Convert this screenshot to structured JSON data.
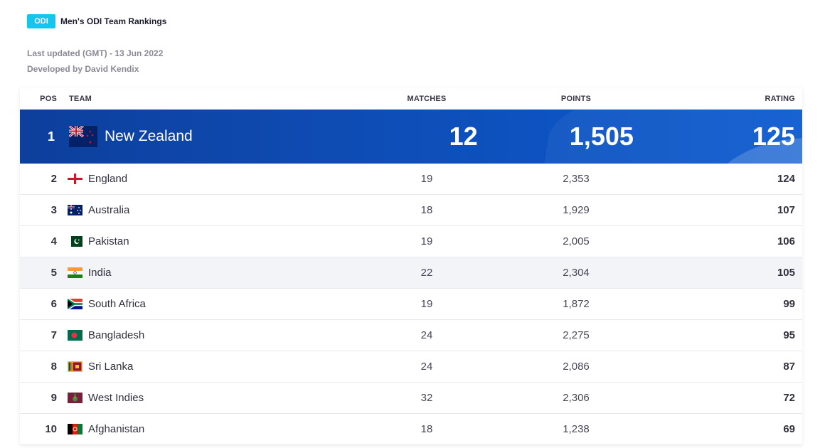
{
  "header": {
    "badge": "ODI",
    "title": "Men's ODI Team Rankings",
    "last_updated": "Last updated (GMT) - 13 Jun 2022",
    "developed_by": "Developed by David Kendix"
  },
  "columns": {
    "pos": "POS",
    "team": "TEAM",
    "matches": "MATCHES",
    "points": "POINTS",
    "rating": "RATING"
  },
  "rows": [
    {
      "pos": "1",
      "team": "New Zealand",
      "matches": "12",
      "points": "1,505",
      "rating": "125",
      "flag_icon": "new-zealand-flag-icon"
    },
    {
      "pos": "2",
      "team": "England",
      "matches": "19",
      "points": "2,353",
      "rating": "124",
      "flag_icon": "england-flag-icon"
    },
    {
      "pos": "3",
      "team": "Australia",
      "matches": "18",
      "points": "1,929",
      "rating": "107",
      "flag_icon": "australia-flag-icon"
    },
    {
      "pos": "4",
      "team": "Pakistan",
      "matches": "19",
      "points": "2,005",
      "rating": "106",
      "flag_icon": "pakistan-flag-icon"
    },
    {
      "pos": "5",
      "team": "India",
      "matches": "22",
      "points": "2,304",
      "rating": "105",
      "flag_icon": "india-flag-icon"
    },
    {
      "pos": "6",
      "team": "South Africa",
      "matches": "19",
      "points": "1,872",
      "rating": "99",
      "flag_icon": "south-africa-flag-icon"
    },
    {
      "pos": "7",
      "team": "Bangladesh",
      "matches": "24",
      "points": "2,275",
      "rating": "95",
      "flag_icon": "bangladesh-flag-icon"
    },
    {
      "pos": "8",
      "team": "Sri Lanka",
      "matches": "24",
      "points": "2,086",
      "rating": "87",
      "flag_icon": "sri-lanka-flag-icon"
    },
    {
      "pos": "9",
      "team": "West Indies",
      "matches": "32",
      "points": "2,306",
      "rating": "72",
      "flag_icon": "west-indies-flag-icon"
    },
    {
      "pos": "10",
      "team": "Afghanistan",
      "matches": "18",
      "points": "1,238",
      "rating": "69",
      "flag_icon": "afghanistan-flag-icon"
    }
  ],
  "colors": {
    "badge": "#12c6ee",
    "top_row_start": "#0d3f9c",
    "top_row_end": "#0b5bd0",
    "alt_row": "#f3f4f8"
  }
}
